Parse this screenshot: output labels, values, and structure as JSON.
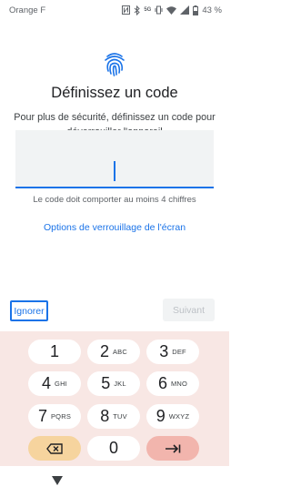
{
  "status_bar": {
    "carrier": "Orange F",
    "battery": "43 %",
    "network": "5G",
    "icons": [
      "nfc-icon",
      "bluetooth-icon",
      "vibrate-icon",
      "wifi-icon",
      "signal-icon",
      "battery-icon"
    ]
  },
  "header": {
    "icon": "fingerprint-icon",
    "title": "Définissez un code",
    "subtitle": "Pour plus de sécurité, définissez un code pour déverrouiller l'appareil"
  },
  "pin_input": {
    "value": "",
    "hint": "Le code doit comporter au moins 4 chiffres"
  },
  "lock_options_link": "Options de verrouillage de l'écran",
  "actions": {
    "ignore": "Ignorer",
    "next": "Suivant"
  },
  "keypad": {
    "keys": [
      {
        "num": "1",
        "letters": ""
      },
      {
        "num": "2",
        "letters": "ABC"
      },
      {
        "num": "3",
        "letters": "DEF"
      },
      {
        "num": "4",
        "letters": "GHI"
      },
      {
        "num": "5",
        "letters": "JKL"
      },
      {
        "num": "6",
        "letters": "MNO"
      },
      {
        "num": "7",
        "letters": "PQRS"
      },
      {
        "num": "8",
        "letters": "TUV"
      },
      {
        "num": "9",
        "letters": "WXYZ"
      },
      {
        "num": "0",
        "letters": ""
      }
    ],
    "backspace_icon": "backspace-icon",
    "enter_icon": "enter-icon"
  },
  "nav": {
    "back_icon": "back-triangle-icon"
  },
  "colors": {
    "accent": "#1a73e8",
    "keypad_bg": "#f8e7e4",
    "backspace_key": "#f6d49e",
    "enter_key": "#f2b5ad"
  }
}
